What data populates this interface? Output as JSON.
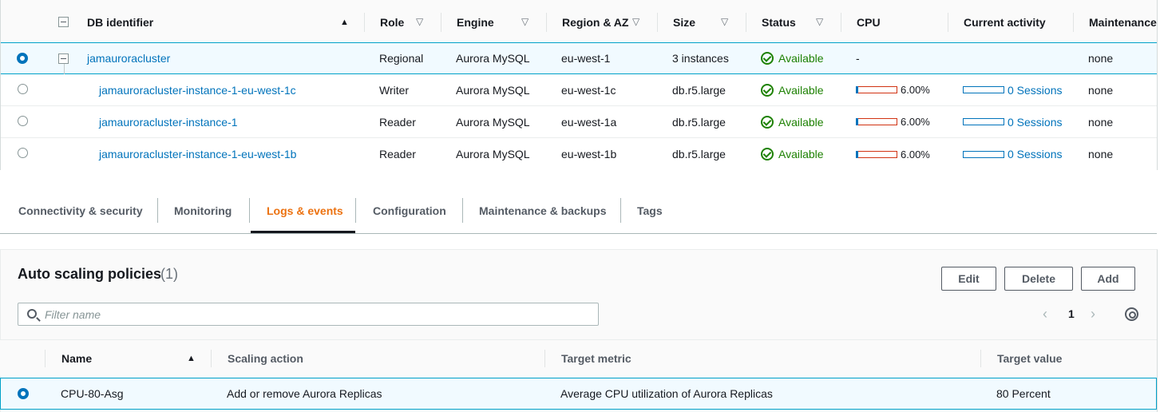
{
  "db_table": {
    "columns": [
      "DB identifier",
      "Role",
      "Engine",
      "Region & AZ",
      "Size",
      "Status",
      "CPU",
      "Current activity",
      "Maintenance"
    ],
    "rows": [
      {
        "id": "jamauroracluster",
        "role": "Regional",
        "engine": "Aurora MySQL",
        "region": "eu-west-1",
        "size": "3 instances",
        "status": "Available",
        "cpu": "-",
        "activity": "",
        "maintenance": "none",
        "selected": true
      },
      {
        "id": "jamauroracluster-instance-1-eu-west-1c",
        "role": "Writer",
        "engine": "Aurora MySQL",
        "region": "eu-west-1c",
        "size": "db.r5.large",
        "status": "Available",
        "cpu": "6.00%",
        "cpu_fraction": 0.06,
        "activity": "0 Sessions",
        "maintenance": "none",
        "selected": false
      },
      {
        "id": "jamauroracluster-instance-1",
        "role": "Reader",
        "engine": "Aurora MySQL",
        "region": "eu-west-1a",
        "size": "db.r5.large",
        "status": "Available",
        "cpu": "6.00%",
        "cpu_fraction": 0.06,
        "activity": "0 Sessions",
        "maintenance": "none",
        "selected": false
      },
      {
        "id": "jamauroracluster-instance-1-eu-west-1b",
        "role": "Reader",
        "engine": "Aurora MySQL",
        "region": "eu-west-1b",
        "size": "db.r5.large",
        "status": "Available",
        "cpu": "6.00%",
        "cpu_fraction": 0.06,
        "activity": "0 Sessions",
        "maintenance": "none",
        "selected": false
      }
    ]
  },
  "tabs": [
    {
      "label": "Connectivity & security",
      "active": false
    },
    {
      "label": "Monitoring",
      "active": false
    },
    {
      "label": "Logs & events",
      "active": true
    },
    {
      "label": "Configuration",
      "active": false
    },
    {
      "label": "Maintenance & backups",
      "active": false
    },
    {
      "label": "Tags",
      "active": false
    }
  ],
  "autoscaling": {
    "title": "Auto scaling policies",
    "count": "(1)",
    "buttons": {
      "edit": "Edit",
      "delete": "Delete",
      "add": "Add"
    },
    "filter_placeholder": "Filter name",
    "page": "1",
    "columns": [
      "Name",
      "Scaling action",
      "Target metric",
      "Target value"
    ],
    "rows": [
      {
        "name": "CPU-80-Asg",
        "action": "Add or remove Aurora Replicas",
        "metric": "Average CPU utilization of Aurora Replicas",
        "value": "80 Percent",
        "selected": true
      }
    ]
  },
  "colors": {
    "link": "#0073bb",
    "available": "#1d8102",
    "active_tab": "#ec7211",
    "selected_row": "#f1faff"
  }
}
